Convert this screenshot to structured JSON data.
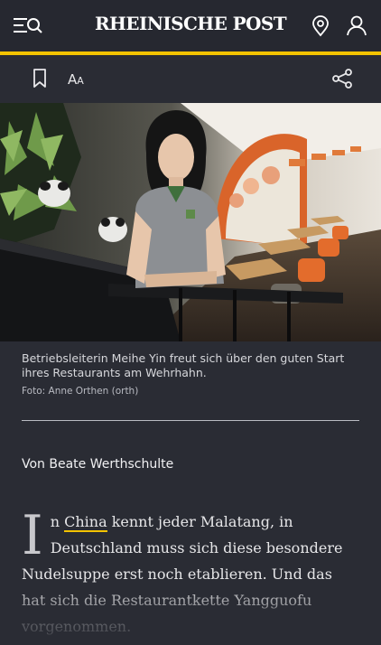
{
  "header": {
    "logo": "RHEINISCHE POST",
    "accent_color": "#f3c300",
    "icons": [
      "menu-search-icon",
      "location-icon",
      "user-icon"
    ]
  },
  "toolbar": {
    "font_size_label": "AA",
    "icons": [
      "bookmark-icon",
      "text-size-icon",
      "share-icon"
    ]
  },
  "article": {
    "image_caption": "Betriebsleiterin Meihe Yin freut sich über den guten Start ihres Restaurants am Wehrhahn.",
    "photo_credit": "Foto: Anne Orthen (orth)",
    "author": "Von Beate Werthschulte",
    "drop_cap": "I",
    "body_after_dropcap": "n ",
    "link_text": "China",
    "body_rest": " kennt jeder Malatang, in Deutschland muss sich diese besondere Nudelsuppe erst noch etablieren. Und das hat sich die Restaurantkette Yangguofu vorgenommen."
  }
}
